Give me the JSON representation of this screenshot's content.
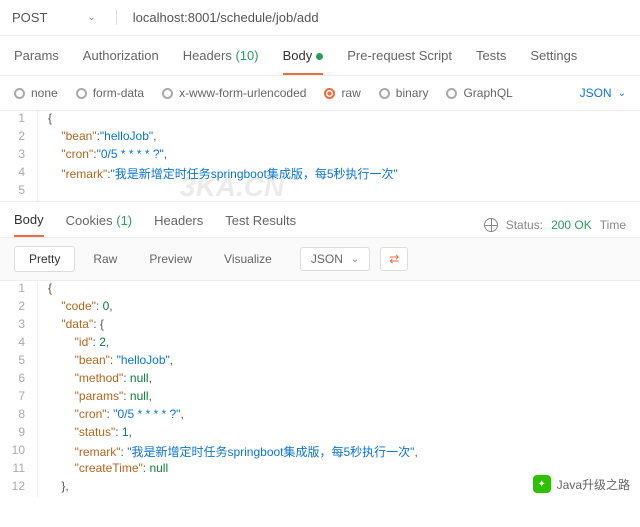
{
  "request": {
    "method": "POST",
    "url": "localhost:8001/schedule/job/add"
  },
  "tabs": {
    "params": "Params",
    "auth": "Authorization",
    "headers": "Headers",
    "headers_count": "(10)",
    "body": "Body",
    "prereq": "Pre-request Script",
    "tests": "Tests",
    "settings": "Settings"
  },
  "body_types": {
    "none": "none",
    "formdata": "form-data",
    "urlencoded": "x-www-form-urlencoded",
    "raw": "raw",
    "binary": "binary",
    "graphql": "GraphQL",
    "format": "JSON"
  },
  "request_body": {
    "l1": "{",
    "l2a": "\"bean\"",
    "l2b": ":",
    "l2c": "\"helloJob\"",
    "l2d": ",",
    "l3a": "\"cron\"",
    "l3b": ":",
    "l3c": "\"0/5 * * * * ?\"",
    "l3d": ",",
    "l4a": "\"remark\"",
    "l4b": ":",
    "l4c": "\"我是新增定时任务springboot集成版，每5秒执行一次\""
  },
  "chart_data": {
    "type": "table",
    "title": "Request JSON payload",
    "data": {
      "bean": "helloJob",
      "cron": "0/5 * * * * ?",
      "remark": "我是新增定时任务springboot集成版，每5秒执行一次"
    }
  },
  "watermark": "3KA.CN",
  "response_tabs": {
    "body": "Body",
    "cookies": "Cookies",
    "cookies_count": "(1)",
    "headers": "Headers",
    "results": "Test Results"
  },
  "status": {
    "label": "Status:",
    "code": "200 OK",
    "time": "Time"
  },
  "resp_toolbar": {
    "pretty": "Pretty",
    "raw": "Raw",
    "preview": "Preview",
    "visualize": "Visualize",
    "format": "JSON"
  },
  "response_body": {
    "l1": "{",
    "l2a": "\"code\"",
    "l2b": ": ",
    "l2c": "0",
    "l2d": ",",
    "l3a": "\"data\"",
    "l3b": ": {",
    "l4a": "\"id\"",
    "l4b": ": ",
    "l4c": "2",
    "l4d": ",",
    "l5a": "\"bean\"",
    "l5b": ": ",
    "l5c": "\"helloJob\"",
    "l5d": ",",
    "l6a": "\"method\"",
    "l6b": ": ",
    "l6c": "null",
    "l6d": ",",
    "l7a": "\"params\"",
    "l7b": ": ",
    "l7c": "null",
    "l7d": ",",
    "l8a": "\"cron\"",
    "l8b": ": ",
    "l8c": "\"0/5 * * * * ?\"",
    "l8d": ",",
    "l9a": "\"status\"",
    "l9b": ": ",
    "l9c": "1",
    "l9d": ",",
    "l10a": "\"remark\"",
    "l10b": ": ",
    "l10c": "\"我是新增定时任务springboot集成版，每5秒执行一次\"",
    "l10d": ",",
    "l11a": "\"createTime\"",
    "l11b": ": ",
    "l11c": "null",
    "l12": "},"
  },
  "response_data": {
    "type": "table",
    "title": "Response JSON",
    "data": {
      "code": 0,
      "data": {
        "id": 2,
        "bean": "helloJob",
        "method": null,
        "params": null,
        "cron": "0/5 * * * * ?",
        "status": 1,
        "remark": "我是新增定时任务springboot集成版，每5秒执行一次",
        "createTime": null
      }
    }
  },
  "footer": "Java升级之路"
}
